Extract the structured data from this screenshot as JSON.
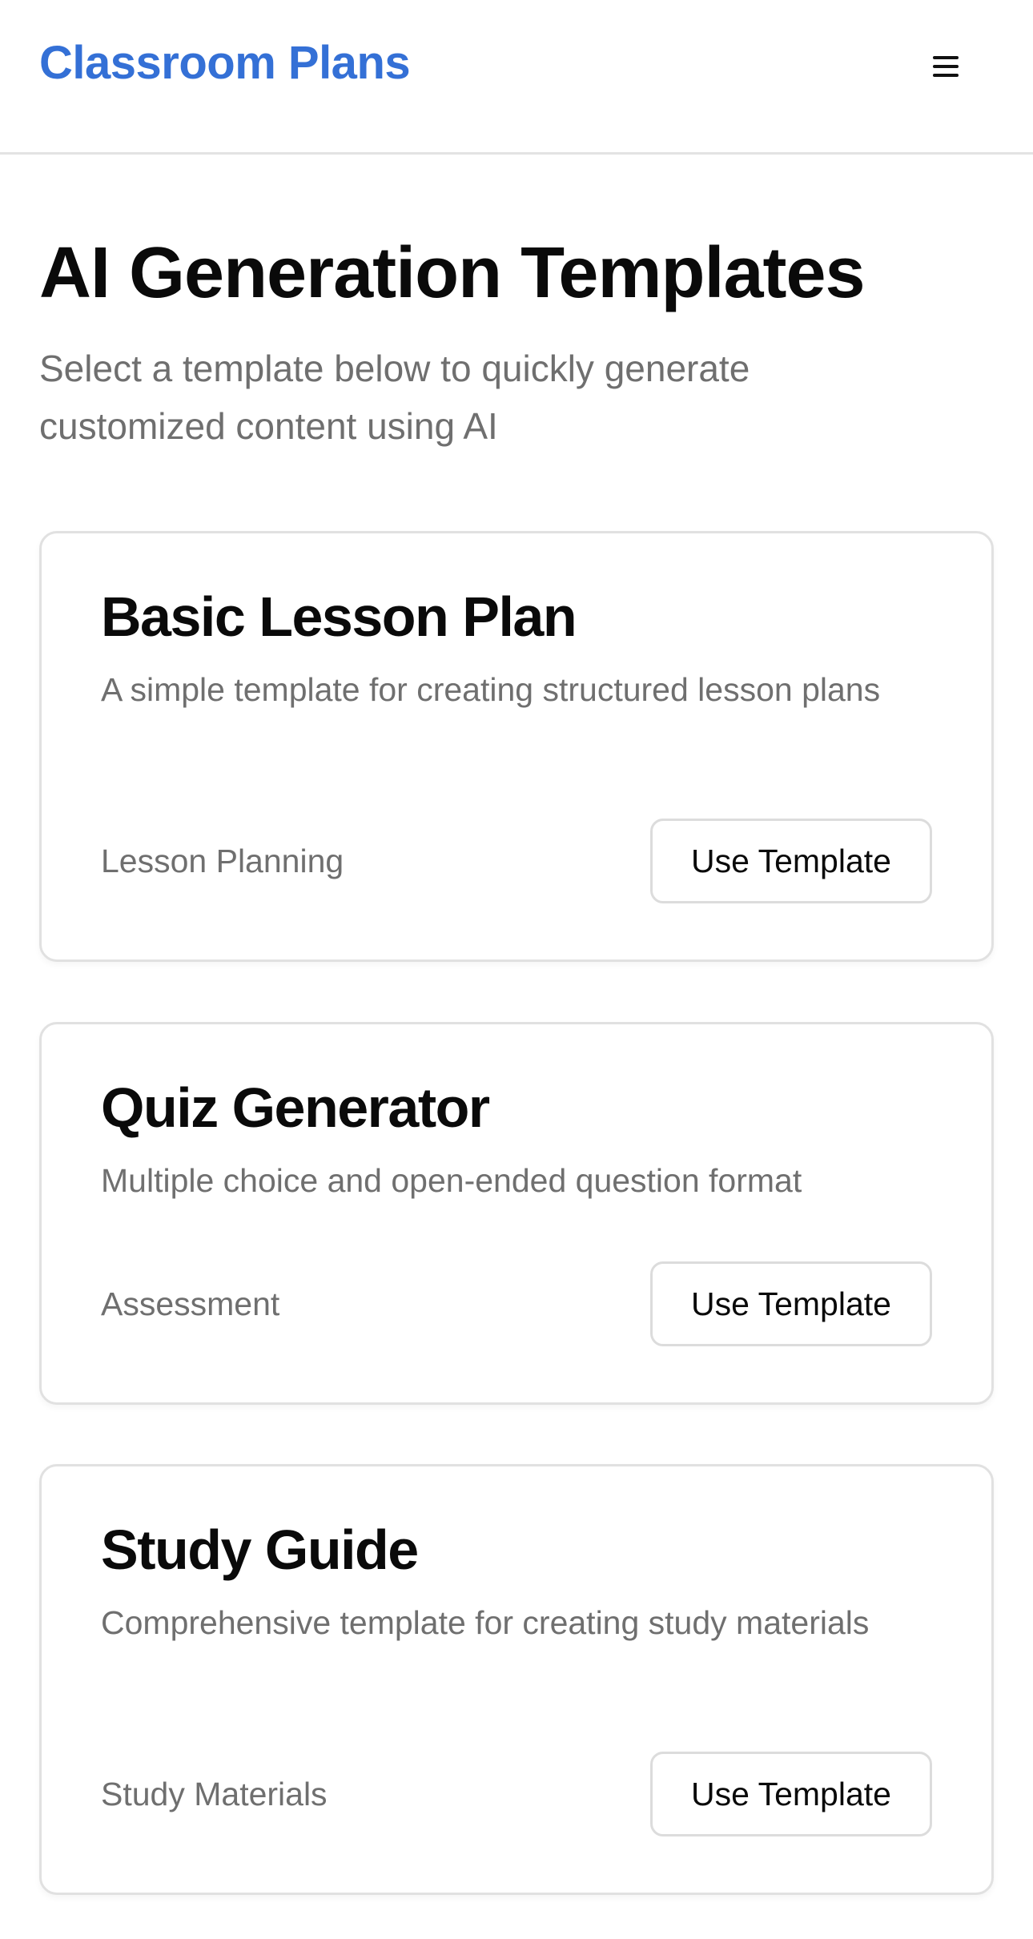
{
  "colors": {
    "accent": "#3470d6",
    "text_primary": "#0a0a0a",
    "text_muted": "#6f6f6f",
    "border": "#e1e1e1"
  },
  "header": {
    "brand": "Classroom Plans",
    "menu_icon": "hamburger-menu-icon"
  },
  "main": {
    "title": "AI Generation Templates",
    "subtitle": "Select a template below to quickly generate customized content using AI"
  },
  "templates": [
    {
      "title": "Basic Lesson Plan",
      "description": "A simple template for creating structured lesson plans",
      "category": "Lesson Planning",
      "button_label": "Use Template"
    },
    {
      "title": "Quiz Generator",
      "description": "Multiple choice and open-ended question format",
      "category": "Assessment",
      "button_label": "Use Template"
    },
    {
      "title": "Study Guide",
      "description": "Comprehensive template for creating study materials",
      "category": "Study Materials",
      "button_label": "Use Template"
    }
  ]
}
